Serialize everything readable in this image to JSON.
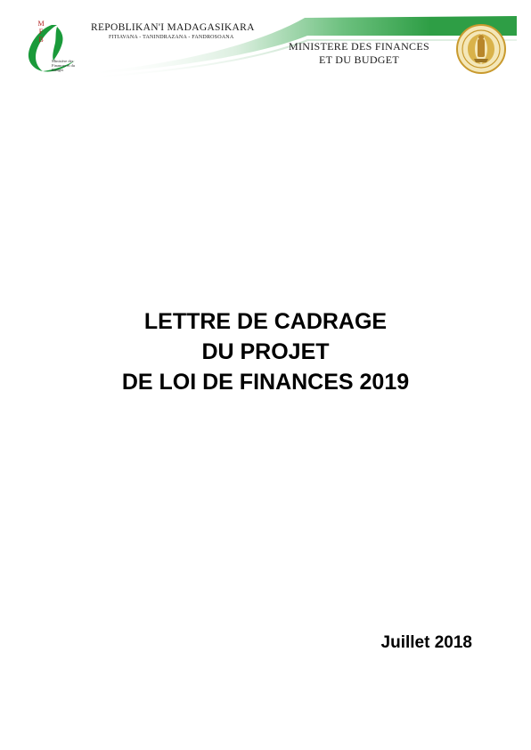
{
  "header": {
    "logo": {
      "letters": [
        "M",
        "F",
        "B"
      ],
      "caption": "Ministère des Finances et du Budget",
      "brand_color": "#1a9a3a",
      "accent_color": "#b22222"
    },
    "republic": "REPOBLIKAN'I MADAGASIKARA",
    "motto": "FITIAVANA - TANINDRAZANA - FANDROSOANA",
    "ministry_line1": "MINISTERE DES FINANCES",
    "ministry_line2": "ET DU BUDGET",
    "seal_icon": "coat-of-arms-icon",
    "swoosh_color": "#2e9e45"
  },
  "document": {
    "title_line1": "LETTRE DE CADRAGE",
    "title_line2": "DU PROJET",
    "title_line3": "DE LOI DE FINANCES 2019",
    "date": "Juillet 2018"
  }
}
